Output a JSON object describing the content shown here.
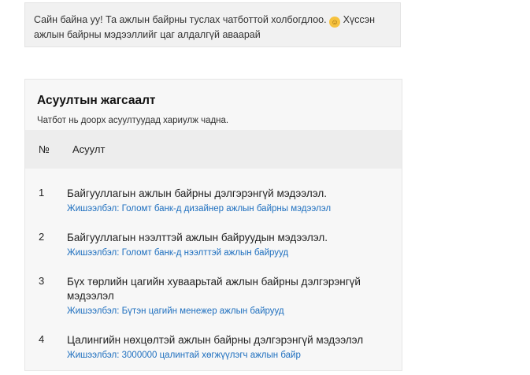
{
  "greeting": {
    "text": "Сайн байна уу! Та ажлын байрны туслах чатботтой холбогдлоо.",
    "emoji_icon": "hugging-face-icon",
    "text2": "Хүссэн ажлын байрны мэдээллийг цаг алдалгүй аваарай"
  },
  "questions_card": {
    "title": "Асуултын жагсаалт",
    "subtitle": "Чатбот нь доорх асуултуудад хариулж чадна.",
    "columns": {
      "number": "№",
      "question": "Асуулт"
    },
    "rows": [
      {
        "no": "1",
        "question": "Байгууллагын ажлын байрны дэлгэрэнгүй мэдээлэл.",
        "example": "Жишээлбэл: Голомт банк-д дизайнер ажлын байрны мэдээлэл"
      },
      {
        "no": "2",
        "question": "Байгууллагын нээлттэй ажлын байруудын мэдээлэл.",
        "example": "Жишээлбэл: Голомт банк-д нээлттэй ажлын байрууд"
      },
      {
        "no": "3",
        "question": "Бүх төрлийн цагийн хуваарьтай ажлын байрны дэлгэрэнгүй мэдээлэл",
        "example": "Жишээлбэл: Бүтэн цагийн менежер ажлын байрууд"
      },
      {
        "no": "4",
        "question": "Цалингийн нөхцөлтэй ажлын байрны дэлгэрэнгүй мэдээлэл",
        "example": "Жишээлбэл: 3000000 цалинтай хөгжүүлэгч ажлын байр"
      }
    ]
  }
}
